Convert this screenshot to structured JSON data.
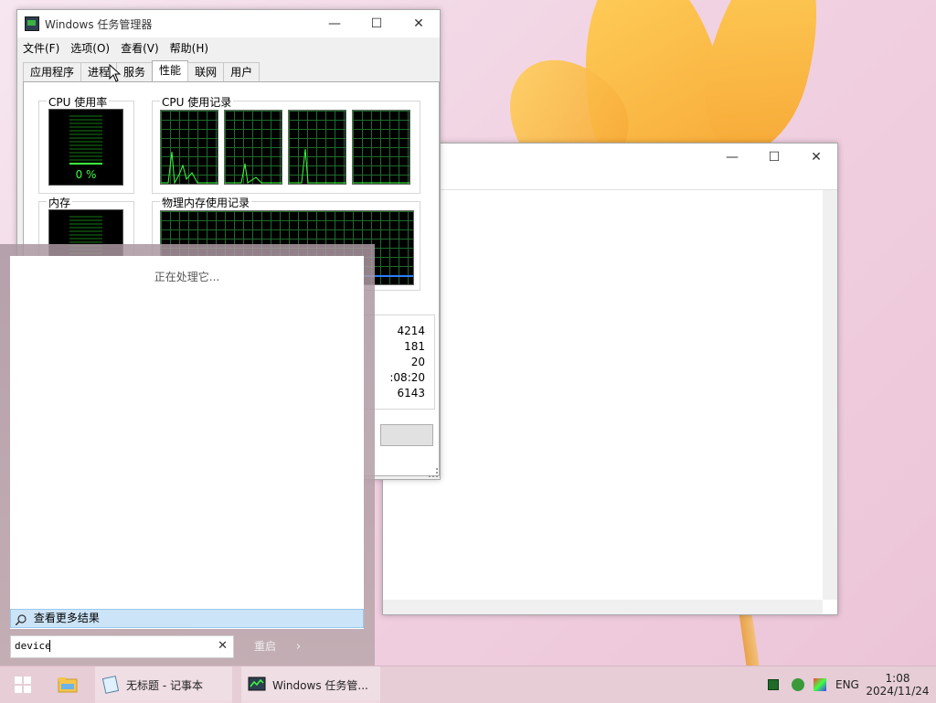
{
  "taskmgr": {
    "title": "Windows 任务管理器",
    "menu": [
      "文件(F)",
      "选项(O)",
      "查看(V)",
      "帮助(H)"
    ],
    "tabs": [
      "应用程序",
      "进程",
      "服务",
      "性能",
      "联网",
      "用户"
    ],
    "active_tab": "性能",
    "cpu_usage_label": "CPU 使用率",
    "cpu_usage_value": "0 %",
    "cpu_history_label": "CPU 使用记录",
    "memory_label": "内存",
    "memory_history_label": "物理内存使用记录",
    "stats": [
      "4214",
      "181",
      "20",
      ":08:20",
      "6143"
    ]
  },
  "notepad": {
    "title": ""
  },
  "search": {
    "processing_text": "正在处理它...",
    "more_results_label": "查看更多结果",
    "query": "device",
    "restart_label": "重启"
  },
  "taskbar": {
    "apps": [
      {
        "label": "无标题 - 记事本"
      },
      {
        "label": "Windows 任务管..."
      }
    ],
    "language": "ENG",
    "time": "1:08",
    "date": "2024/11/24"
  }
}
